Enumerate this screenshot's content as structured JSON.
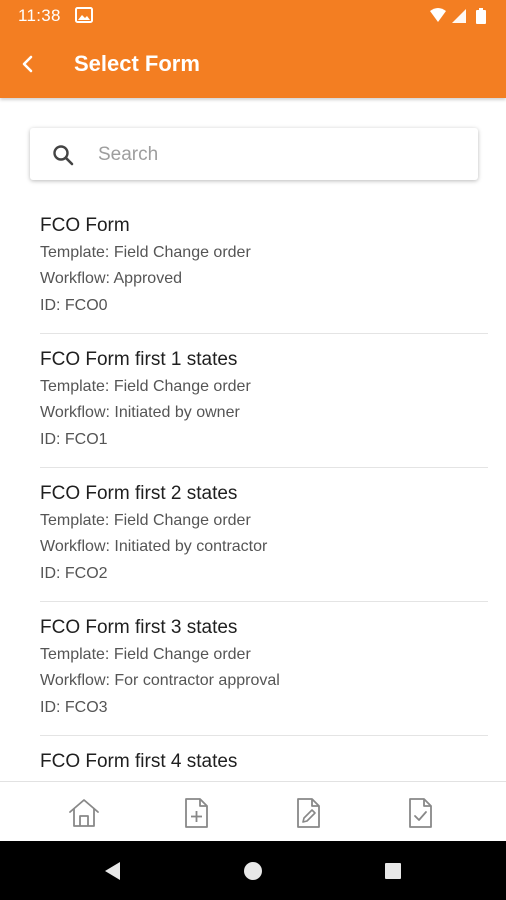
{
  "status_bar": {
    "time": "11:38"
  },
  "app_bar": {
    "title": "Select Form",
    "background_color": "#f37e22"
  },
  "search": {
    "placeholder": "Search",
    "value": ""
  },
  "forms": [
    {
      "title": "FCO Form",
      "template": "Template: Field Change order",
      "workflow": "Workflow: Approved",
      "id": "ID: FCO0"
    },
    {
      "title": "FCO Form first 1 states",
      "template": "Template: Field Change order",
      "workflow": "Workflow: Initiated by owner",
      "id": "ID: FCO1"
    },
    {
      "title": "FCO Form first 2 states",
      "template": "Template: Field Change order",
      "workflow": "Workflow: Initiated by contractor",
      "id": "ID: FCO2"
    },
    {
      "title": "FCO Form first 3 states",
      "template": "Template: Field Change order",
      "workflow": "Workflow: For contractor approval",
      "id": "ID: FCO3"
    },
    {
      "title": "FCO Form first 4 states",
      "template": "",
      "workflow": "",
      "id": ""
    }
  ],
  "bottom_nav": {
    "items": [
      {
        "icon": "home-icon"
      },
      {
        "icon": "new-document-icon"
      },
      {
        "icon": "edit-document-icon"
      },
      {
        "icon": "approved-document-icon"
      }
    ]
  },
  "system_nav": {
    "items": [
      {
        "icon": "back-triangle-icon"
      },
      {
        "icon": "home-circle-icon"
      },
      {
        "icon": "recents-square-icon"
      }
    ]
  }
}
